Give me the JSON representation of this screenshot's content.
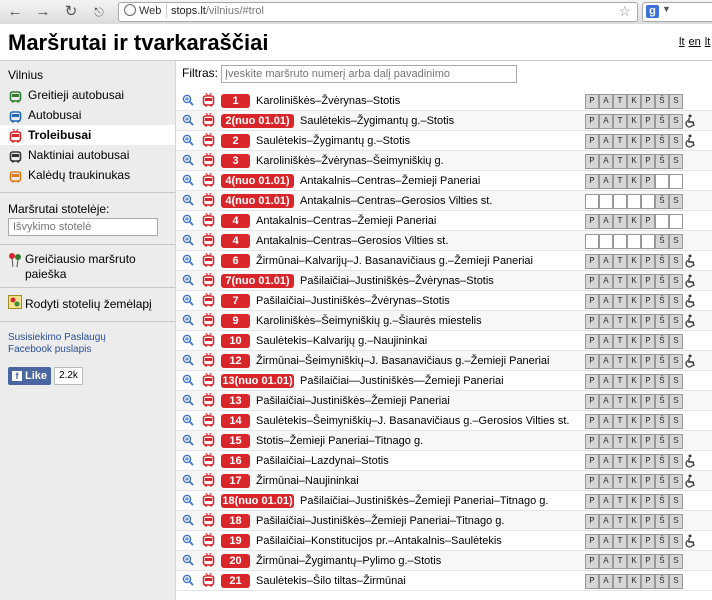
{
  "browser": {
    "web_label": "Web",
    "url_host": "stops.lt",
    "url_path": "/vilnius/#trol",
    "search_engine_label": "g"
  },
  "header": {
    "title": "Maršrutai ir tvarkaraščiai",
    "lang_lt": "lt",
    "lang_en": "en",
    "lang_more": "lt"
  },
  "sidebar": {
    "city": "Vilnius",
    "items": [
      {
        "label": "Greitieji autobusai",
        "icon": "bus-icon",
        "color": "#2f7d2f"
      },
      {
        "label": "Autobusai",
        "icon": "bus-icon",
        "color": "#2468b8"
      },
      {
        "label": "Troleibusai",
        "icon": "trolleybus-icon",
        "color": "#d8262a"
      },
      {
        "label": "Naktiniai autobusai",
        "icon": "bus-icon",
        "color": "#333333"
      },
      {
        "label": "Kalėdų traukinukas",
        "icon": "bus-icon",
        "color": "#e07b1a"
      }
    ],
    "stops_label": "Maršrutai stotelėje:",
    "stops_placeholder": "Išvykimo stotelė",
    "route_search": "Greičiausio maršruto paieška",
    "map_link": "Rodyti stotelių žemėlapį",
    "links": [
      "Susisiekimo Paslaugų",
      "Facebook puslapis"
    ],
    "fb_like": "Like",
    "fb_count": "2.2k"
  },
  "main": {
    "filter_label": "Filtras:",
    "filter_placeholder": "Įveskite maršruto numerį arba dalį pavadinimo",
    "day_letters": [
      "P",
      "A",
      "T",
      "K",
      "P",
      "Š",
      "S"
    ],
    "routes": [
      {
        "num": "1",
        "name": "Karoliniškės–Žvėrynas–Stotis",
        "days": [
          1,
          1,
          1,
          1,
          1,
          1,
          1
        ],
        "wheel": false
      },
      {
        "num": "2(nuo 01.01)",
        "name": "Saulėtekis–Žygimantų g.–Stotis",
        "days": [
          1,
          1,
          1,
          1,
          1,
          1,
          1
        ],
        "wheel": true
      },
      {
        "num": "2",
        "name": "Saulėtekis–Žygimantų g.–Stotis",
        "days": [
          1,
          1,
          1,
          1,
          1,
          1,
          1
        ],
        "wheel": true
      },
      {
        "num": "3",
        "name": "Karoliniškės–Žvėrynas–Šeimyniškių g.",
        "days": [
          1,
          1,
          1,
          1,
          1,
          1,
          1
        ],
        "wheel": false
      },
      {
        "num": "4(nuo 01.01)",
        "name": "Antakalnis–Centras–Žemieji Paneriai",
        "days": [
          1,
          1,
          1,
          1,
          1,
          0,
          0
        ],
        "wheel": false
      },
      {
        "num": "4(nuo 01.01)",
        "name": "Antakalnis–Centras–Gerosios Vilties st.",
        "days": [
          0,
          0,
          0,
          0,
          0,
          1,
          1
        ],
        "wheel": false
      },
      {
        "num": "4",
        "name": "Antakalnis–Centras–Žemieji Paneriai",
        "days": [
          1,
          1,
          1,
          1,
          1,
          0,
          0
        ],
        "wheel": false
      },
      {
        "num": "4",
        "name": "Antakalnis–Centras–Gerosios Vilties st.",
        "days": [
          0,
          0,
          0,
          0,
          0,
          1,
          1
        ],
        "wheel": false
      },
      {
        "num": "6",
        "name": "Žirmūnai–Kalvarijų–J. Basanavičiaus g.–Žemieji Paneriai",
        "days": [
          1,
          1,
          1,
          1,
          1,
          1,
          1
        ],
        "wheel": true
      },
      {
        "num": "7(nuo 01.01)",
        "name": "Pašilaičiai–Justiniškės–Žvėrynas–Stotis",
        "days": [
          1,
          1,
          1,
          1,
          1,
          1,
          1
        ],
        "wheel": true
      },
      {
        "num": "7",
        "name": "Pašilaičiai–Justiniškės–Žvėrynas–Stotis",
        "days": [
          1,
          1,
          1,
          1,
          1,
          1,
          1
        ],
        "wheel": true
      },
      {
        "num": "9",
        "name": "Karoliniškės–Šeimyniškių g.–Šiaurės miestelis",
        "days": [
          1,
          1,
          1,
          1,
          1,
          1,
          1
        ],
        "wheel": true
      },
      {
        "num": "10",
        "name": "Saulėtekis–Kalvarijų g.–Naujininkai",
        "days": [
          1,
          1,
          1,
          1,
          1,
          1,
          1
        ],
        "wheel": false
      },
      {
        "num": "12",
        "name": "Žirmūnai–Šeimyniškių–J. Basanavičiaus g.–Žemieji Paneriai",
        "days": [
          1,
          1,
          1,
          1,
          1,
          1,
          1
        ],
        "wheel": true
      },
      {
        "num": "13(nuo 01.01)",
        "name": "Pašilaičiai—Justiniškės—Žemieji Paneriai",
        "days": [
          1,
          1,
          1,
          1,
          1,
          1,
          1
        ],
        "wheel": false
      },
      {
        "num": "13",
        "name": "Pašilaičiai–Justiniškės–Žemieji Paneriai",
        "days": [
          1,
          1,
          1,
          1,
          1,
          1,
          1
        ],
        "wheel": false
      },
      {
        "num": "14",
        "name": "Saulėtekis–Šeimyniškių–J. Basanavičiaus g.–Gerosios Vilties st.",
        "days": [
          1,
          1,
          1,
          1,
          1,
          1,
          1
        ],
        "wheel": false
      },
      {
        "num": "15",
        "name": "Stotis–Žemieji Paneriai–Titnago g.",
        "days": [
          1,
          1,
          1,
          1,
          1,
          1,
          1
        ],
        "wheel": false
      },
      {
        "num": "16",
        "name": "Pašilaičiai–Lazdynai–Stotis",
        "days": [
          1,
          1,
          1,
          1,
          1,
          1,
          1
        ],
        "wheel": true
      },
      {
        "num": "17",
        "name": "Žirmūnai–Naujininkai",
        "days": [
          1,
          1,
          1,
          1,
          1,
          1,
          1
        ],
        "wheel": true
      },
      {
        "num": "18(nuo 01.01)",
        "name": "Pašilaičiai–Justiniškės–Žemieji Paneriai–Titnago g.",
        "days": [
          1,
          1,
          1,
          1,
          1,
          1,
          1
        ],
        "wheel": false
      },
      {
        "num": "18",
        "name": "Pašilaičiai–Justiniškės–Žemieji Paneriai–Titnago g.",
        "days": [
          1,
          1,
          1,
          1,
          1,
          1,
          1
        ],
        "wheel": false
      },
      {
        "num": "19",
        "name": "Pašilaičiai–Konstitucijos pr.–Antakalnis–Saulėtekis",
        "days": [
          1,
          1,
          1,
          1,
          1,
          1,
          1
        ],
        "wheel": true
      },
      {
        "num": "20",
        "name": "Žirmūnai–Žygimantų–Pylimo g.–Stotis",
        "days": [
          1,
          1,
          1,
          1,
          1,
          1,
          1
        ],
        "wheel": false
      },
      {
        "num": "21",
        "name": "Saulėtekis–Šilo tiltas–Žirmūnai",
        "days": [
          1,
          1,
          1,
          1,
          1,
          1,
          1
        ],
        "wheel": false
      }
    ]
  }
}
